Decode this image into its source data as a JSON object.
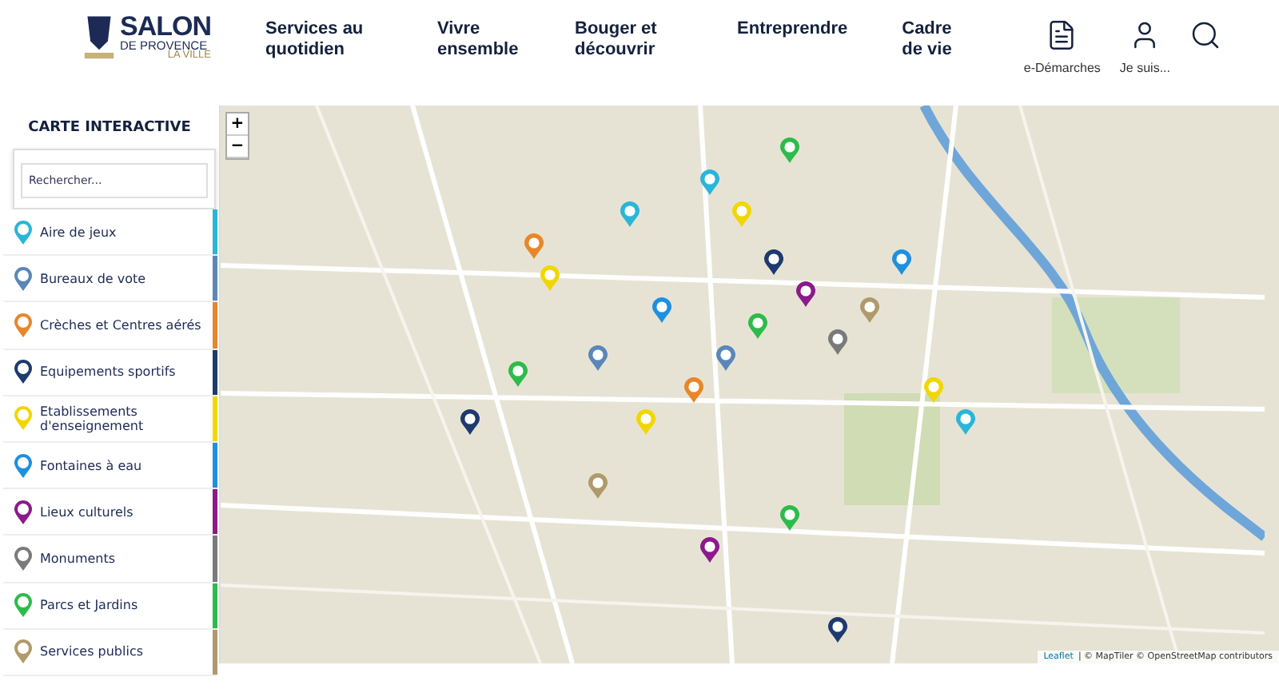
{
  "header": {
    "logo": {
      "title": "SALON",
      "subtitle": "DE PROVENCE",
      "tagline": "LA VILLE"
    },
    "nav": [
      {
        "label": "Services au quotidien"
      },
      {
        "label": "Vivre ensemble"
      },
      {
        "label": "Bouger et découvrir"
      },
      {
        "label": "Entreprendre"
      },
      {
        "label": "Cadre de vie"
      }
    ],
    "actions": [
      {
        "kind": "document",
        "label": "e-Démarches"
      },
      {
        "kind": "user",
        "label": "Je suis..."
      },
      {
        "kind": "search"
      }
    ]
  },
  "sidebar": {
    "title": "CARTE INTERACTIVE",
    "search": {
      "placeholder": "Rechercher..."
    },
    "categories": [
      {
        "label": "Aire de jeux",
        "color": "#29b6d8"
      },
      {
        "label": "Bureaux de vote",
        "color": "#5a87b8"
      },
      {
        "label": "Crèches et Centres aérés",
        "color": "#e8862a"
      },
      {
        "label": "Equipements sportifs",
        "color": "#1e3a6e"
      },
      {
        "label": "Etablissements d'enseignement",
        "color": "#f2d600"
      },
      {
        "label": "Fontaines à eau",
        "color": "#1e90e0"
      },
      {
        "label": "Lieux culturels",
        "color": "#8b1a8b"
      },
      {
        "label": "Monuments",
        "color": "#7a7a7a"
      },
      {
        "label": "Parcs et Jardins",
        "color": "#2dbb4a"
      },
      {
        "label": "Services publics",
        "color": "#b09a6a"
      }
    ]
  },
  "map": {
    "zoom": [
      "+",
      "−"
    ],
    "attribution": {
      "link": "Leaflet",
      "text": "| © MapTiler © OpenStreetMap contributors"
    }
  }
}
